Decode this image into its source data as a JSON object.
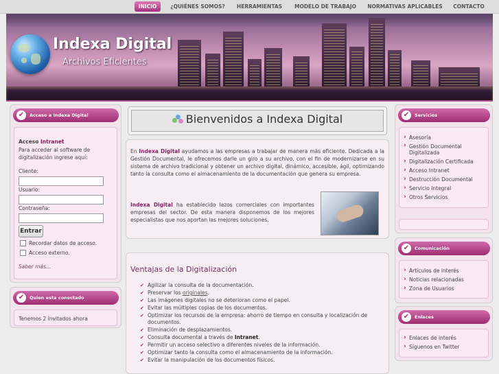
{
  "nav": [
    "INICIO",
    "¿QUIÉNES SOMOS?",
    "HERRAMIENTAS",
    "MODELO DE TRABAJO",
    "NORMATIVAS APLICABLES",
    "CONTACTO"
  ],
  "brand": {
    "title": "Indexa Digital",
    "subtitle": "Archivos Eficientes"
  },
  "login": {
    "header": "Acceso a Indexa Digital",
    "heading_prefix": "Acceso ",
    "heading_strong": "Intranet",
    "intro": "Para acceder al software de digitalización ingrese aquí:",
    "client_label": "Cliente:",
    "user_label": "Usuario:",
    "password_label": "Contraseña:",
    "submit": "Entrar",
    "remember": "Recordar datos de acceso.",
    "external": "Acceso externo.",
    "more": "Saber más..."
  },
  "online": {
    "header": "Quien esta conectado",
    "text": "Tenemos 2 invitados ahora"
  },
  "welcome": {
    "title": "Bienvenidos a Indexa Digital"
  },
  "intro_para": {
    "pre": "En ",
    "brand": "Indexa Digital",
    "text": " ayudamos a las empresas a trabajar de manera más eficiente. Dedicada a la Gestión Documental, le ofrecemos darle un giro a su archivo, con el fin de modernizarse en su sistema de archivo tradicional y obtener un archivo digital, dinámico, accesible, ágil, optimizando tanto la consulta como el almacenamiento de la documentación que genera su empresa."
  },
  "alliances_para": {
    "brand": "Indexa Digital",
    "text": " ha establecido lazos comerciales con importantes empresas del sector. De esta manera disponemos de los mejores especialistas que nos aportan las mejores soluciones."
  },
  "advantages": {
    "title": "Ventajas de la Digitalización",
    "items": [
      "Agilizar la consulta de la documentación.",
      "Preservar los originales.",
      "Las imágenes digitales no se deterioran como el papel.",
      "Evitar las múltiples copias de los documentos.",
      "Optimizar los recursos de la empresa: ahorro de tiempo en consulta y localización de documentos.",
      "Eliminación de desplazamientos.",
      "Consulta documental a través de Intranet.",
      "Permitir un acceso selectivo a diferentes niveles de la información.",
      "Optimizar tanto la consulta como el almacenamiento de la información.",
      "Evitar la manipulación de los documentos físicos."
    ]
  },
  "services": {
    "header": "Servicios",
    "items": [
      "Asesoría",
      "Gestión Documental Digitalizada",
      "Digitalización Certificada",
      "Acceso Intranet",
      "Destrucción Documental",
      "Servicio Integral",
      "Otros Servicios"
    ]
  },
  "communication": {
    "header": "Comunicación",
    "items": [
      "Artículos de interés",
      "Noticias relacionadas",
      "Zona de Usuarios"
    ]
  },
  "links": {
    "header": "Enlaces",
    "items": [
      "Enlaces de interés",
      "Síguenos en Twitter"
    ]
  },
  "colors": {
    "accent": "#a6327b",
    "nav_active": "#c65a9e",
    "panel": "#f3e3ec"
  }
}
